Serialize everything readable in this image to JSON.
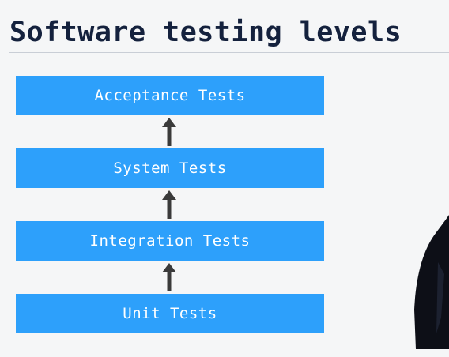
{
  "title": "Software testing levels",
  "levels": [
    {
      "label": "Acceptance Tests"
    },
    {
      "label": "System Tests"
    },
    {
      "label": "Integration Tests"
    },
    {
      "label": "Unit Tests"
    }
  ],
  "colors": {
    "box": "#2da0fb",
    "box_text": "#ffffff",
    "title": "#14213d",
    "arrow": "#3a3a3a",
    "background": "#f5f6f7"
  }
}
